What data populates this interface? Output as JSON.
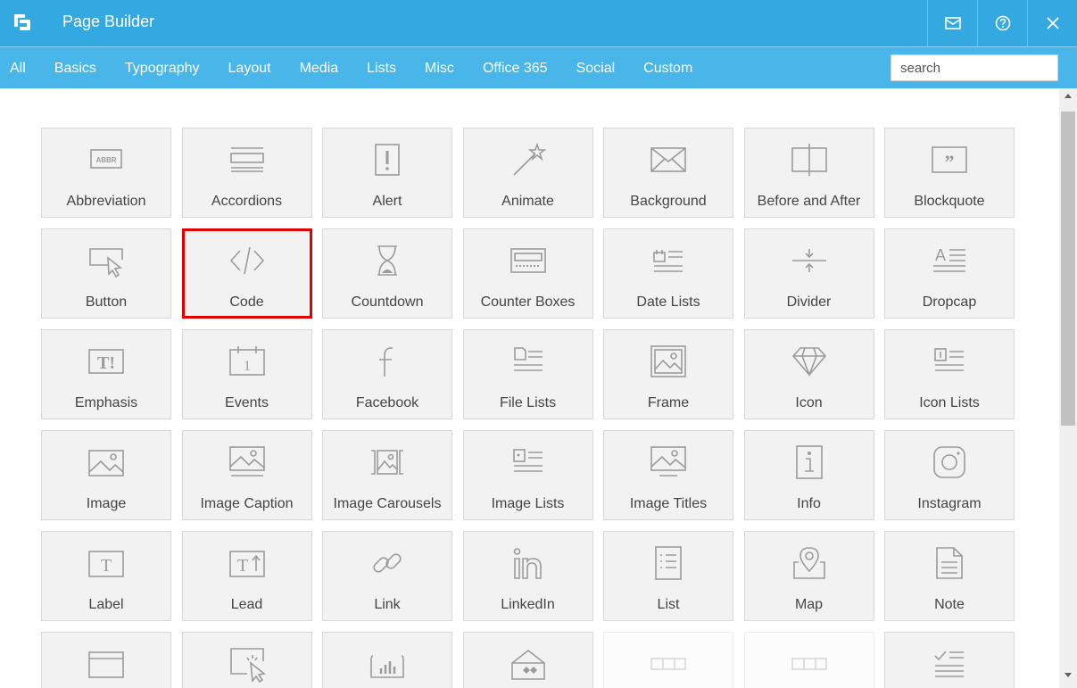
{
  "header": {
    "title": "Page Builder",
    "icons": [
      "logo-icon",
      "mail-icon",
      "help-icon",
      "close-icon"
    ]
  },
  "tabs": [
    "All",
    "Basics",
    "Typography",
    "Layout",
    "Media",
    "Lists",
    "Misc",
    "Office 365",
    "Social",
    "Custom"
  ],
  "search": {
    "placeholder": "search",
    "value": ""
  },
  "widgets": [
    {
      "label": "Abbreviation",
      "icon": "abbr-icon"
    },
    {
      "label": "Accordions",
      "icon": "accordions-icon"
    },
    {
      "label": "Alert",
      "icon": "alert-icon"
    },
    {
      "label": "Animate",
      "icon": "magic-wand-icon"
    },
    {
      "label": "Background",
      "icon": "envelope-background-icon"
    },
    {
      "label": "Before and After",
      "icon": "before-after-icon"
    },
    {
      "label": "Blockquote",
      "icon": "blockquote-icon"
    },
    {
      "label": "Button",
      "icon": "button-cursor-icon"
    },
    {
      "label": "Code",
      "icon": "code-icon",
      "selected": true
    },
    {
      "label": "Countdown",
      "icon": "hourglass-icon"
    },
    {
      "label": "Counter Boxes",
      "icon": "counter-box-icon"
    },
    {
      "label": "Date Lists",
      "icon": "date-list-icon"
    },
    {
      "label": "Divider",
      "icon": "divider-icon"
    },
    {
      "label": "Dropcap",
      "icon": "dropcap-icon"
    },
    {
      "label": "Emphasis",
      "icon": "emphasis-icon"
    },
    {
      "label": "Events",
      "icon": "calendar-icon"
    },
    {
      "label": "Facebook",
      "icon": "facebook-icon"
    },
    {
      "label": "File Lists",
      "icon": "file-list-icon"
    },
    {
      "label": "Frame",
      "icon": "frame-icon"
    },
    {
      "label": "Icon",
      "icon": "diamond-icon"
    },
    {
      "label": "Icon Lists",
      "icon": "icon-list-icon"
    },
    {
      "label": "Image",
      "icon": "image-icon"
    },
    {
      "label": "Image Caption",
      "icon": "image-caption-icon"
    },
    {
      "label": "Image Carousels",
      "icon": "image-carousel-icon"
    },
    {
      "label": "Image Lists",
      "icon": "image-list-icon"
    },
    {
      "label": "Image Titles",
      "icon": "image-title-icon"
    },
    {
      "label": "Info",
      "icon": "info-icon"
    },
    {
      "label": "Instagram",
      "icon": "instagram-icon"
    },
    {
      "label": "Label",
      "icon": "label-icon"
    },
    {
      "label": "Lead",
      "icon": "lead-icon"
    },
    {
      "label": "Link",
      "icon": "link-icon"
    },
    {
      "label": "LinkedIn",
      "icon": "linkedin-icon"
    },
    {
      "label": "List",
      "icon": "list-icon"
    },
    {
      "label": "Map",
      "icon": "map-pin-icon"
    },
    {
      "label": "Note",
      "icon": "note-icon"
    },
    {
      "label": "",
      "icon": "panel-icon"
    },
    {
      "label": "",
      "icon": "popup-cursor-icon"
    },
    {
      "label": "",
      "icon": "chart-icon"
    },
    {
      "label": "",
      "icon": "power-bi-icon"
    },
    {
      "label": "",
      "icon": "progress-icon",
      "faded": true
    },
    {
      "label": "",
      "icon": "progress-icon",
      "faded": true
    },
    {
      "label": "",
      "icon": "checklist-icon"
    }
  ],
  "colors": {
    "header": "#34a8e0",
    "nav": "#49b6ea",
    "card": "#f2f2f2",
    "icon": "#9a9a9a",
    "selection": "#e00000"
  }
}
